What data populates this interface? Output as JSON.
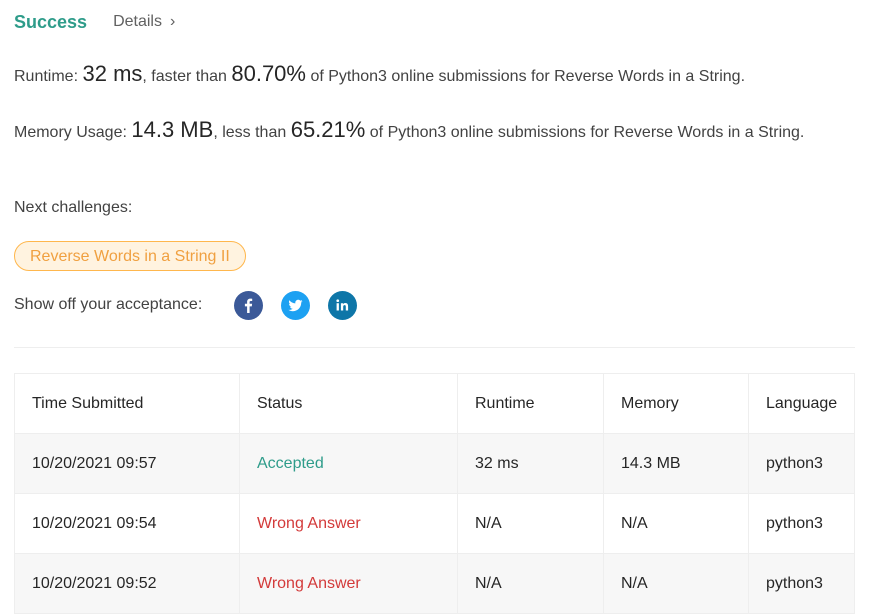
{
  "header": {
    "status": "Success",
    "details_label": "Details",
    "chevron": "›"
  },
  "runtime": {
    "label": "Runtime:",
    "value": "32 ms",
    "mid": ", faster than",
    "percent": "80.70%",
    "suffix": "of Python3 online submissions for Reverse Words in a String."
  },
  "memory": {
    "label": "Memory Usage:",
    "value": "14.3 MB",
    "mid": ", less than",
    "percent": "65.21%",
    "suffix": "of Python3 online submissions for Reverse Words in a String."
  },
  "next": {
    "label": "Next challenges:",
    "challenge": "Reverse Words in a String II"
  },
  "share": {
    "label": "Show off your acceptance:",
    "icons": [
      "facebook-icon",
      "twitter-icon",
      "linkedin-icon"
    ]
  },
  "table": {
    "headers": [
      "Time Submitted",
      "Status",
      "Runtime",
      "Memory",
      "Language"
    ],
    "rows": [
      {
        "time": "10/20/2021 09:57",
        "status": "Accepted",
        "runtime": "32 ms",
        "memory": "14.3 MB",
        "language": "python3"
      },
      {
        "time": "10/20/2021 09:54",
        "status": "Wrong Answer",
        "runtime": "N/A",
        "memory": "N/A",
        "language": "python3"
      },
      {
        "time": "10/20/2021 09:52",
        "status": "Wrong Answer",
        "runtime": "N/A",
        "memory": "N/A",
        "language": "python3"
      }
    ]
  },
  "colors": {
    "success": "#2e9c8a",
    "wrong": "#d33a3a",
    "pill_border": "#ffb74d",
    "pill_text": "#f0a040"
  }
}
